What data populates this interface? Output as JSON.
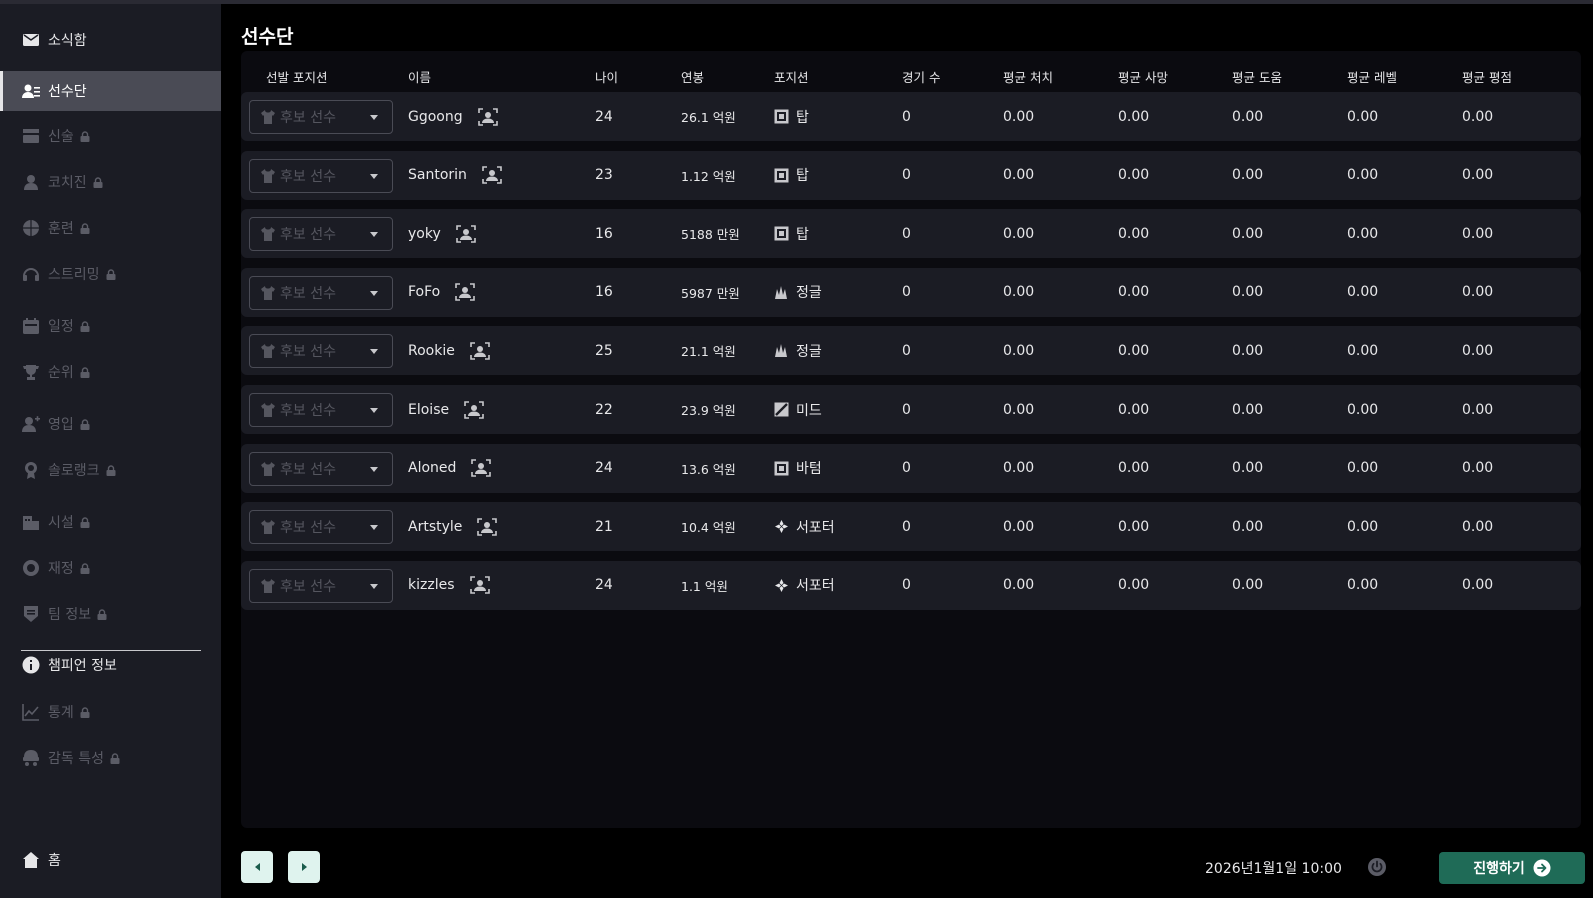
{
  "sidebar": {
    "items": [
      {
        "label": "소식함",
        "icon": "mail-icon",
        "locked": false,
        "active": false
      },
      {
        "label": "선수단",
        "icon": "roster-icon",
        "locked": false,
        "active": true
      },
      {
        "label": "신술",
        "icon": "tactics-icon",
        "locked": true,
        "active": false
      },
      {
        "label": "코치진",
        "icon": "coach-icon",
        "locked": true,
        "active": false
      },
      {
        "label": "훈련",
        "icon": "training-icon",
        "locked": true,
        "active": false
      },
      {
        "label": "스트리밍",
        "icon": "headphones-icon",
        "locked": true,
        "active": false
      },
      {
        "label": "일정",
        "icon": "calendar-icon",
        "locked": true,
        "active": false
      },
      {
        "label": "순위",
        "icon": "trophy-icon",
        "locked": true,
        "active": false
      },
      {
        "label": "영입",
        "icon": "add-person-icon",
        "locked": true,
        "active": false
      },
      {
        "label": "솔로랭크",
        "icon": "medal-icon",
        "locked": true,
        "active": false
      },
      {
        "label": "시설",
        "icon": "building-icon",
        "locked": true,
        "active": false
      },
      {
        "label": "재정",
        "icon": "coins-icon",
        "locked": true,
        "active": false
      },
      {
        "label": "팀 정보",
        "icon": "shield-icon",
        "locked": true,
        "active": false
      },
      {
        "label": "챔피언 정보",
        "icon": "info-icon",
        "locked": false,
        "active": false
      },
      {
        "label": "통계",
        "icon": "chart-icon",
        "locked": true,
        "active": false
      },
      {
        "label": "감독 특성",
        "icon": "manager-icon",
        "locked": true,
        "active": false
      }
    ],
    "home_label": "홈"
  },
  "page": {
    "title": "선수단"
  },
  "table": {
    "columns": [
      "선발 포지션",
      "이름",
      "나이",
      "연봉",
      "포지션",
      "경기 수",
      "평균 처치",
      "평균 사망",
      "평균 도움",
      "평균 레벨",
      "평균 평점"
    ],
    "select_placeholder": "후보 선수",
    "rows": [
      {
        "name": "Ggoong",
        "age": "24",
        "salary": "26.1 억원",
        "position": "탑",
        "pos_icon": "top-lane-icon",
        "games": "0",
        "kills": "0.00",
        "deaths": "0.00",
        "assists": "0.00",
        "level": "0.00",
        "rating": "0.00"
      },
      {
        "name": "Santorin",
        "age": "23",
        "salary": "1.12 억원",
        "position": "탑",
        "pos_icon": "top-lane-icon",
        "games": "0",
        "kills": "0.00",
        "deaths": "0.00",
        "assists": "0.00",
        "level": "0.00",
        "rating": "0.00"
      },
      {
        "name": "yoky",
        "age": "16",
        "salary": "5188 만원",
        "position": "탑",
        "pos_icon": "top-lane-icon",
        "games": "0",
        "kills": "0.00",
        "deaths": "0.00",
        "assists": "0.00",
        "level": "0.00",
        "rating": "0.00"
      },
      {
        "name": "FoFo",
        "age": "16",
        "salary": "5987 만원",
        "position": "정글",
        "pos_icon": "jungle-icon",
        "games": "0",
        "kills": "0.00",
        "deaths": "0.00",
        "assists": "0.00",
        "level": "0.00",
        "rating": "0.00"
      },
      {
        "name": "Rookie",
        "age": "25",
        "salary": "21.1 억원",
        "position": "정글",
        "pos_icon": "jungle-icon",
        "games": "0",
        "kills": "0.00",
        "deaths": "0.00",
        "assists": "0.00",
        "level": "0.00",
        "rating": "0.00"
      },
      {
        "name": "Eloise",
        "age": "22",
        "salary": "23.9 억원",
        "position": "미드",
        "pos_icon": "mid-lane-icon",
        "games": "0",
        "kills": "0.00",
        "deaths": "0.00",
        "assists": "0.00",
        "level": "0.00",
        "rating": "0.00"
      },
      {
        "name": "Aloned",
        "age": "24",
        "salary": "13.6 억원",
        "position": "바텀",
        "pos_icon": "bottom-lane-icon",
        "games": "0",
        "kills": "0.00",
        "deaths": "0.00",
        "assists": "0.00",
        "level": "0.00",
        "rating": "0.00"
      },
      {
        "name": "Artstyle",
        "age": "21",
        "salary": "10.4 억원",
        "position": "서포터",
        "pos_icon": "support-icon",
        "games": "0",
        "kills": "0.00",
        "deaths": "0.00",
        "assists": "0.00",
        "level": "0.00",
        "rating": "0.00"
      },
      {
        "name": "kizzles",
        "age": "24",
        "salary": "1.1 억원",
        "position": "서포터",
        "pos_icon": "support-icon",
        "games": "0",
        "kills": "0.00",
        "deaths": "0.00",
        "assists": "0.00",
        "level": "0.00",
        "rating": "0.00"
      }
    ]
  },
  "footer": {
    "datetime": "2026년1월1일 10:00",
    "proceed_label": "진행하기"
  },
  "colors": {
    "sidebar_bg": "#1b1c24",
    "active_item_bg": "#4a4b55",
    "row_bg": "#1b1c24",
    "accent": "#1f6b57",
    "pager_bg": "#dff3ee"
  }
}
